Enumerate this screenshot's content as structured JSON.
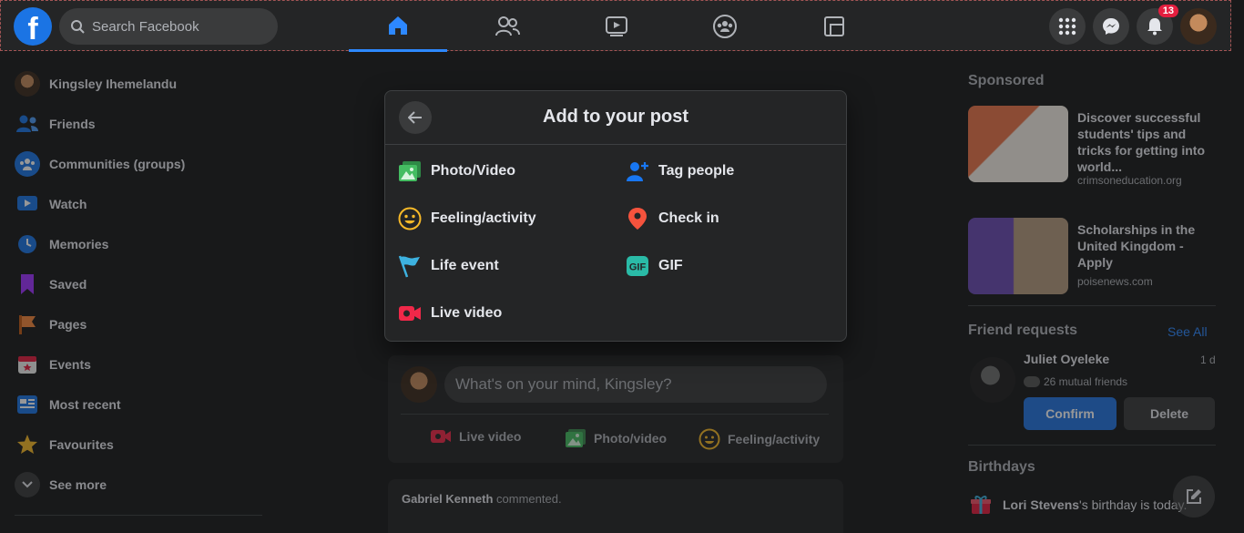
{
  "topbar": {
    "logo": "f",
    "search_placeholder": "Search Facebook",
    "notifications_count": "13"
  },
  "sidebar": {
    "items": [
      {
        "label": "Kingsley Ihemelandu",
        "icon": "avatar"
      },
      {
        "label": "Friends",
        "icon": "friends-icon"
      },
      {
        "label": "Communities (groups)",
        "icon": "groups-icon"
      },
      {
        "label": "Watch",
        "icon": "watch-icon"
      },
      {
        "label": "Memories",
        "icon": "memories-icon"
      },
      {
        "label": "Saved",
        "icon": "saved-icon"
      },
      {
        "label": "Pages",
        "icon": "pages-icon"
      },
      {
        "label": "Events",
        "icon": "events-icon"
      },
      {
        "label": "Most recent",
        "icon": "most-recent-icon"
      },
      {
        "label": "Favourites",
        "icon": "favourites-icon"
      },
      {
        "label": "See more",
        "icon": "chevron-down-icon"
      }
    ]
  },
  "composer": {
    "placeholder": "What's on your mind, Kingsley?",
    "actions": [
      "Live video",
      "Photo/video",
      "Feeling/activity"
    ]
  },
  "feed": {
    "activity_name": "Gabriel Kenneth",
    "activity_text": " commented."
  },
  "right": {
    "sponsored_title": "Sponsored",
    "ads": [
      {
        "title": "Discover successful students' tips and tricks for getting into world...",
        "domain": "crimsoneducation.org"
      },
      {
        "title": "Scholarships in the United Kingdom - Apply",
        "domain": "poisenews.com"
      }
    ],
    "friend_requests": {
      "title": "Friend requests",
      "see_all": "See All",
      "name": "Juliet Oyeleke",
      "time": "1 d",
      "mutual": "26 mutual friends",
      "confirm": "Confirm",
      "delete": "Delete"
    },
    "birthdays": {
      "title": "Birthdays",
      "name": "Lori Stevens",
      "text": "'s birthday is today."
    }
  },
  "modal": {
    "title": "Add to your post",
    "options": [
      {
        "label": "Photo/Video",
        "icon": "photo-video-icon",
        "color": "#45bd62"
      },
      {
        "label": "Tag people",
        "icon": "tag-people-icon",
        "color": "#1877f2"
      },
      {
        "label": "Feeling/activity",
        "icon": "feeling-icon",
        "color": "#f7b928"
      },
      {
        "label": "Check in",
        "icon": "check-in-icon",
        "color": "#f5533d"
      },
      {
        "label": "Life event",
        "icon": "life-event-icon",
        "color": "#3db2e0"
      },
      {
        "label": "GIF",
        "icon": "gif-icon",
        "color": "#2abba7"
      },
      {
        "label": "Live video",
        "icon": "live-video-icon",
        "color": "#f02849"
      }
    ]
  }
}
